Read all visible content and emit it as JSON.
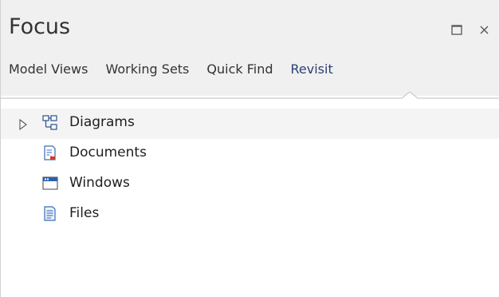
{
  "panel": {
    "title": "Focus",
    "maximize_icon": "maximize-icon",
    "close_icon": "close-icon"
  },
  "tabs": [
    {
      "label": "Model Views",
      "active": false
    },
    {
      "label": "Working Sets",
      "active": false
    },
    {
      "label": "Quick Find",
      "active": false
    },
    {
      "label": "Revisit",
      "active": true
    }
  ],
  "tree": {
    "items": [
      {
        "label": "Diagrams",
        "icon": "diagram-icon",
        "expandable": true
      },
      {
        "label": "Documents",
        "icon": "document-icon",
        "expandable": false
      },
      {
        "label": "Windows",
        "icon": "window-icon",
        "expandable": false
      },
      {
        "label": "Files",
        "icon": "file-icon",
        "expandable": false
      }
    ]
  },
  "colors": {
    "header_bg": "#f0f0f0",
    "active_tab": "#2d3f73",
    "icon_blue": "#2a5fb0"
  }
}
